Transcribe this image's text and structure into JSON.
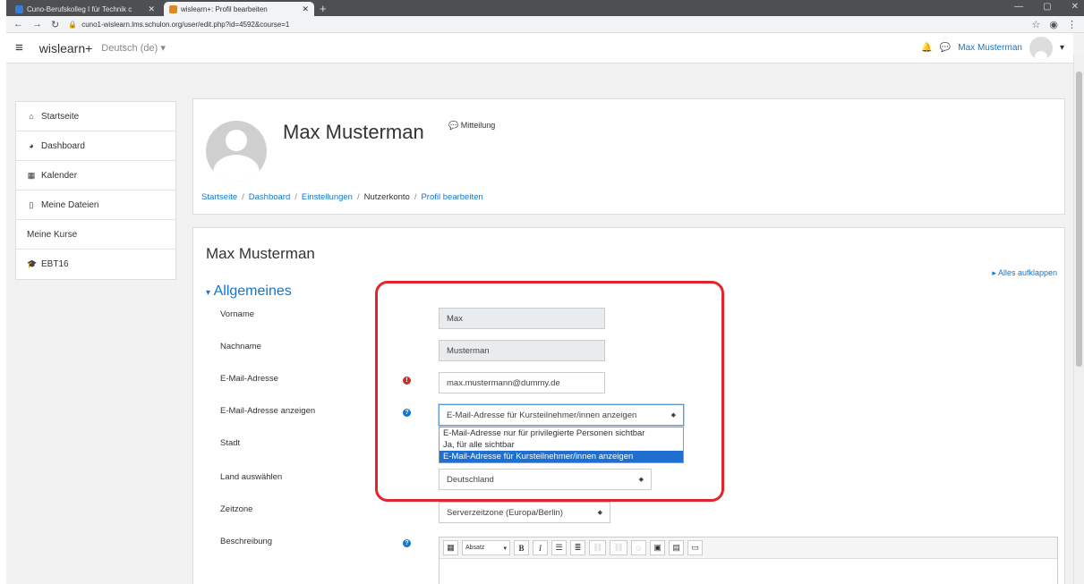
{
  "browser": {
    "tabs": [
      {
        "label": "Cuno-Berufskolleg I für Technik c",
        "active": false
      },
      {
        "label": "wislearn+: Profil bearbeiten",
        "active": true
      }
    ],
    "new_tab": "+",
    "url": "cuno1-wislearn.lms.schulon.org/user/edit.php?id=4592&course=1"
  },
  "navbar": {
    "brand": "wislearn+",
    "language": "Deutsch (de)",
    "user_name": "Max Musterman"
  },
  "sidebar": {
    "items": [
      {
        "label": "Startseite",
        "icon": "home-icon"
      },
      {
        "label": "Dashboard",
        "icon": "dashboard-icon"
      },
      {
        "label": "Kalender",
        "icon": "calendar-icon"
      },
      {
        "label": "Meine Dateien",
        "icon": "file-icon"
      },
      {
        "label": "Meine Kurse",
        "icon": ""
      },
      {
        "label": "EBT16",
        "icon": "graduation-cap-icon"
      }
    ]
  },
  "header": {
    "user_name": "Max Musterman",
    "message_label": "Mitteilung",
    "breadcrumb": [
      {
        "label": "Startseite",
        "link": true
      },
      {
        "label": "Dashboard",
        "link": true
      },
      {
        "label": "Einstellungen",
        "link": true
      },
      {
        "label": "Nutzerkonto",
        "link": false
      },
      {
        "label": "Profil bearbeiten",
        "link": true
      }
    ],
    "separator": "/"
  },
  "form": {
    "title": "Max Musterman",
    "expand_all": "Alles aufklappen",
    "section": "Allgemeines",
    "fields": {
      "firstname": {
        "label": "Vorname",
        "value": "Max"
      },
      "lastname": {
        "label": "Nachname",
        "value": "Musterman"
      },
      "email": {
        "label": "E-Mail-Adresse",
        "value": "max.mustermann@dummy.de"
      },
      "email_display": {
        "label": "E-Mail-Adresse anzeigen",
        "value": "E-Mail-Adresse für Kursteilnehmer/innen anzeigen",
        "options": [
          "E-Mail-Adresse nur für privilegierte Personen sichtbar",
          "Ja, für alle sichtbar",
          "E-Mail-Adresse für Kursteilnehmer/innen anzeigen"
        ],
        "selected_index": 2
      },
      "city": {
        "label": "Stadt"
      },
      "country": {
        "label": "Land auswählen",
        "value": "Deutschland"
      },
      "timezone": {
        "label": "Zeitzone",
        "value": "Serverzeitzone (Europa/Berlin)"
      },
      "description": {
        "label": "Beschreibung"
      }
    },
    "editor": {
      "paragraph_label": "Absatz",
      "bold": "B",
      "italic": "I"
    }
  },
  "colors": {
    "link": "#1177d1",
    "required": "#ca3120",
    "highlight": "#e3242b",
    "dropdown_selected": "#1e6fcf"
  }
}
